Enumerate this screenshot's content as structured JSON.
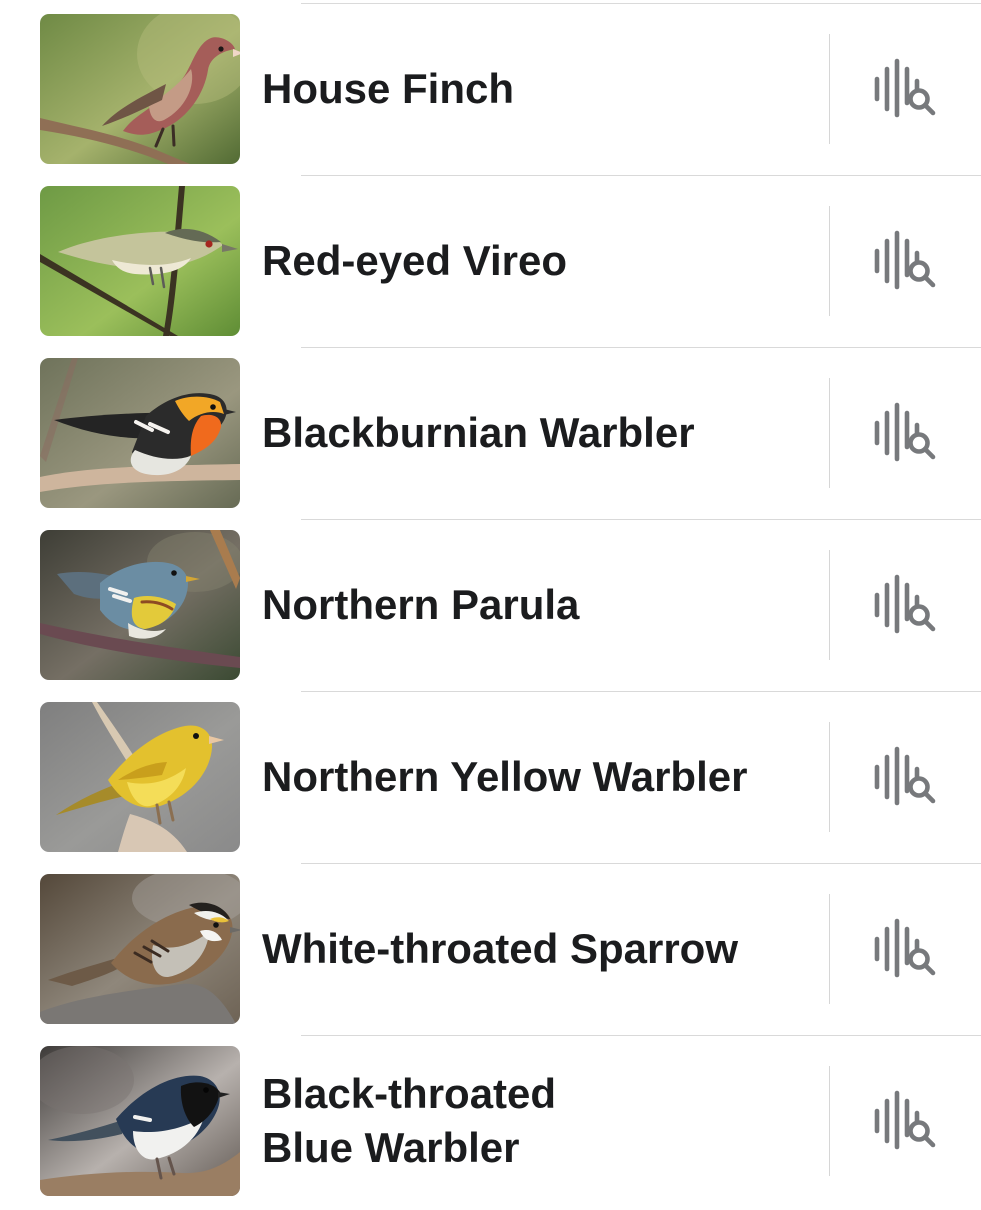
{
  "list": {
    "items": [
      {
        "name": "House Finch",
        "image_icon": "house-finch-photo",
        "action_icon": "sound-search-icon"
      },
      {
        "name": "Red-eyed Vireo",
        "image_icon": "red-eyed-vireo-photo",
        "action_icon": "sound-search-icon"
      },
      {
        "name": "Blackburnian Warbler",
        "image_icon": "blackburnian-warbler-photo",
        "action_icon": "sound-search-icon"
      },
      {
        "name": "Northern Parula",
        "image_icon": "northern-parula-photo",
        "action_icon": "sound-search-icon"
      },
      {
        "name": "Northern Yellow Warbler",
        "image_icon": "northern-yellow-warbler-photo",
        "action_icon": "sound-search-icon"
      },
      {
        "name": "White-throated Sparrow",
        "image_icon": "white-throated-sparrow-photo",
        "action_icon": "sound-search-icon"
      },
      {
        "name": "Black-throated\nBlue Warbler",
        "image_icon": "black-throated-blue-warbler-photo",
        "action_icon": "sound-search-icon"
      }
    ]
  },
  "colors": {
    "text": "#1b1c1e",
    "icon": "#77797c",
    "divider": "#d9d9d9",
    "background": "#ffffff"
  }
}
